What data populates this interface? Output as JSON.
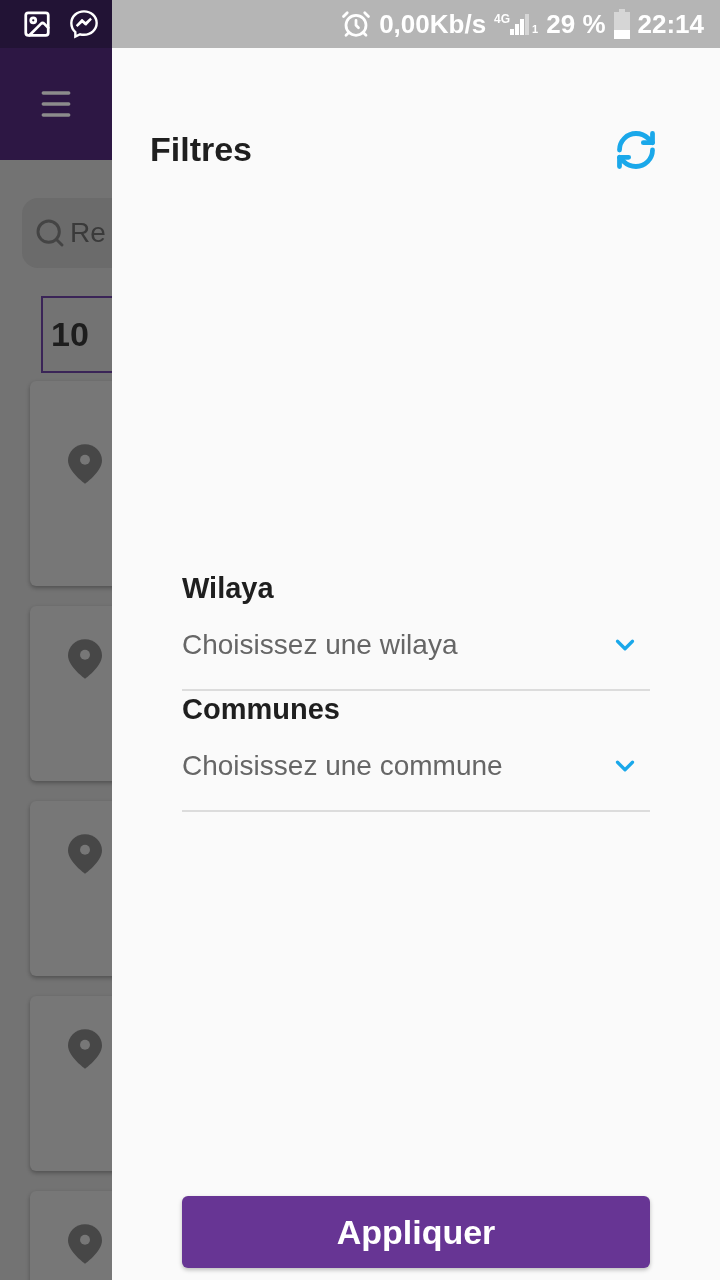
{
  "status_bar": {
    "speed": "0,00Kb/s",
    "network": "4G",
    "sim": "1",
    "battery": "29 %",
    "time": "22:14"
  },
  "background": {
    "search_placeholder": "Re",
    "count": "10"
  },
  "drawer": {
    "title": "Filtres",
    "fields": [
      {
        "label": "Wilaya",
        "placeholder": "Choisissez une wilaya"
      },
      {
        "label": "Communes",
        "placeholder": "Choisissez une commune"
      }
    ],
    "apply_button": "Appliquer"
  }
}
